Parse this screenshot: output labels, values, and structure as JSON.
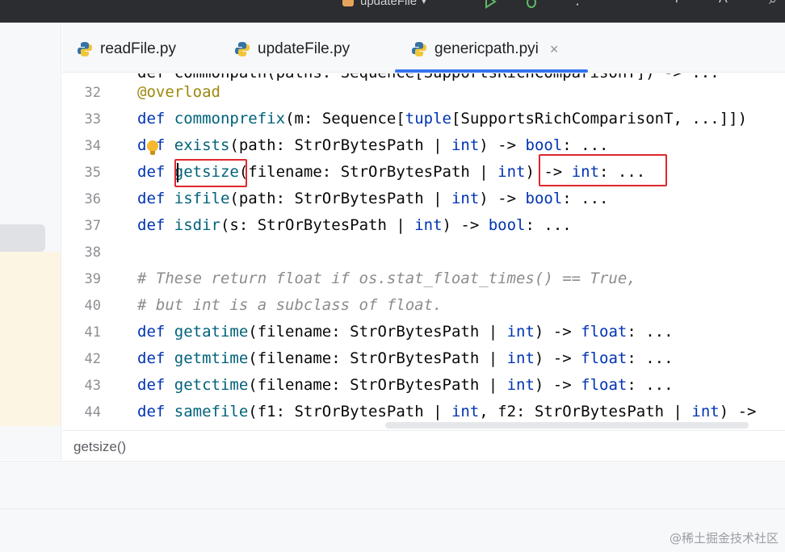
{
  "toolbar": {
    "run_config": "updateFile",
    "icons": [
      "run-icon",
      "debug-icon",
      "more-icon",
      "add-user-icon",
      "translate-icon",
      "search-icon"
    ]
  },
  "tabs": [
    {
      "label": "readFile.py",
      "icon": "python-file-icon",
      "active": false
    },
    {
      "label": "updateFile.py",
      "icon": "python-file-icon",
      "active": false
    },
    {
      "label": "genericpath.pyi",
      "icon": "python-file-icon",
      "active": true,
      "close": "×"
    }
  ],
  "editor": {
    "cut_top_line": "def commonpath(paths: Sequence[SupportsRichComparisonT]) -> ...",
    "lines": [
      {
        "number": "32",
        "text": "@overload"
      },
      {
        "number": "33",
        "text": "def commonprefix(m: Sequence[tuple[SupportsRichComparisonT, ...]])"
      },
      {
        "number": "34",
        "text": "def exists(path: StrOrBytesPath | int) -> bool: ..."
      },
      {
        "number": "35",
        "text": "def getsize(filename: StrOrBytesPath | int) -> int: ..."
      },
      {
        "number": "36",
        "text": "def isfile(path: StrOrBytesPath | int) -> bool: ..."
      },
      {
        "number": "37",
        "text": "def isdir(s: StrOrBytesPath | int) -> bool: ..."
      },
      {
        "number": "38",
        "text": ""
      },
      {
        "number": "39",
        "text": "# These return float if os.stat_float_times() == True,"
      },
      {
        "number": "40",
        "text": "# but int is a subclass of float."
      },
      {
        "number": "41",
        "text": "def getatime(filename: StrOrBytesPath | int) -> float: ..."
      },
      {
        "number": "42",
        "text": "def getmtime(filename: StrOrBytesPath | int) -> float: ..."
      },
      {
        "number": "43",
        "text": "def getctime(filename: StrOrBytesPath | int) -> float: ..."
      },
      {
        "number": "44",
        "text": "def samefile(f1: StrOrBytesPath | int, f2: StrOrBytesPath | int) ->"
      }
    ],
    "highlight_color": "#e0272b"
  },
  "breadcrumb": "getsize()",
  "watermark": "@稀土掘金技术社区"
}
